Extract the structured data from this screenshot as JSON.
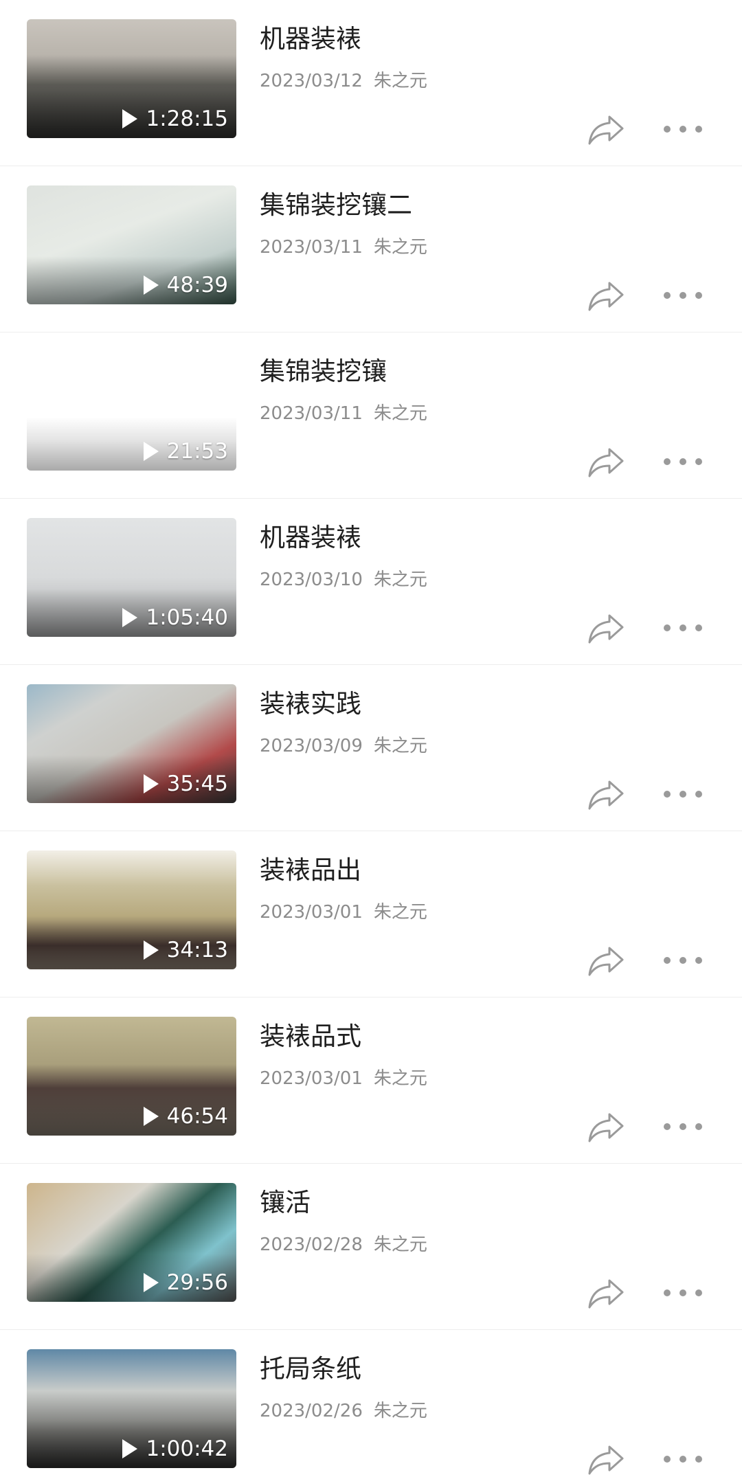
{
  "videos": [
    {
      "title": "机器装裱",
      "date": "2023/03/12",
      "author": "朱之元",
      "duration": "1:28:15"
    },
    {
      "title": "集锦装挖镶二",
      "date": "2023/03/11",
      "author": "朱之元",
      "duration": "48:39"
    },
    {
      "title": "集锦装挖镶",
      "date": "2023/03/11",
      "author": "朱之元",
      "duration": "21:53"
    },
    {
      "title": "机器装裱",
      "date": "2023/03/10",
      "author": "朱之元",
      "duration": "1:05:40"
    },
    {
      "title": "装裱实践",
      "date": "2023/03/09",
      "author": "朱之元",
      "duration": "35:45"
    },
    {
      "title": "装裱品出",
      "date": "2023/03/01",
      "author": "朱之元",
      "duration": "34:13"
    },
    {
      "title": "装裱品式",
      "date": "2023/03/01",
      "author": "朱之元",
      "duration": "46:54"
    },
    {
      "title": "镶活",
      "date": "2023/02/28",
      "author": "朱之元",
      "duration": "29:56"
    },
    {
      "title": "托局条纸",
      "date": "2023/02/26",
      "author": "朱之元",
      "duration": "1:00:42"
    }
  ],
  "icons": {
    "play": "play-icon",
    "share": "share-icon",
    "more": "more-icon"
  },
  "colors": {
    "title": "#1f1f1f",
    "meta": "#8c8c8c",
    "icon": "#9a9a9a",
    "divider": "#ededed"
  }
}
